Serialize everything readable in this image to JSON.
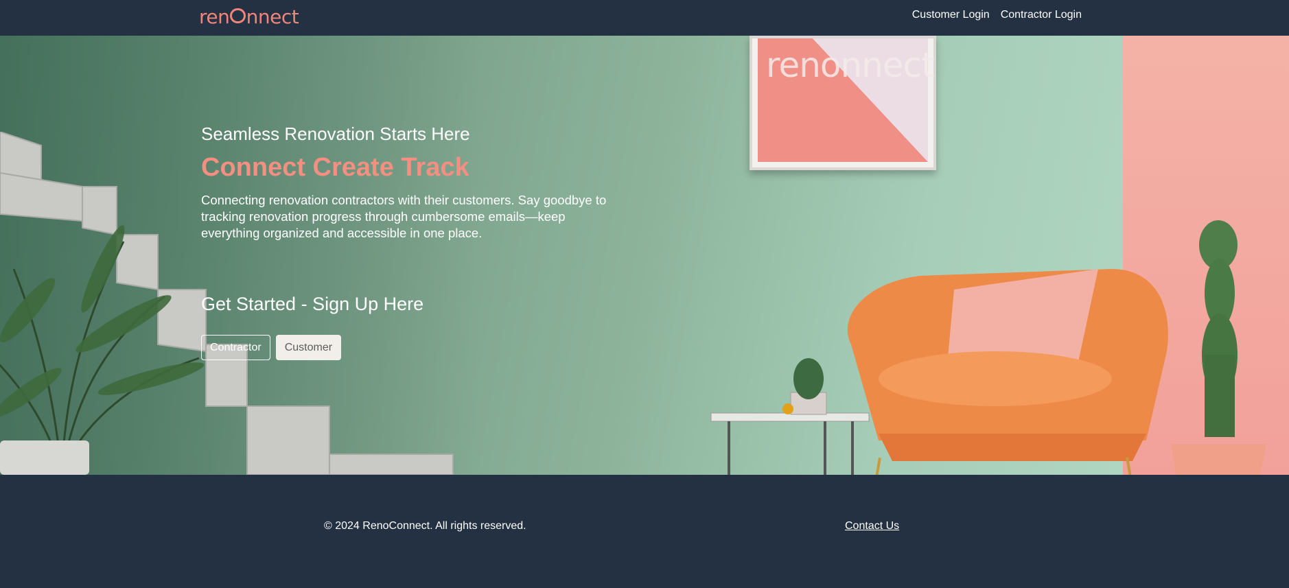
{
  "header": {
    "logo_text_a": "ren",
    "logo_text_b": "nnect",
    "nav": [
      {
        "label": "Customer Login"
      },
      {
        "label": "Contractor Login"
      }
    ]
  },
  "hero": {
    "frame_logo": "renonnect",
    "eyebrow": "Seamless Renovation Starts Here",
    "headline": "Connect Create Track",
    "description": "Connecting renovation contractors with their customers. Say goodbye to tracking renovation progress through cumbersome emails—keep everything organized and accessible in one place.",
    "cta_title": "Get Started - Sign Up Here",
    "buttons": {
      "contractor": "Contractor",
      "customer": "Customer"
    }
  },
  "footer": {
    "copyright": "© 2024 RenoConnect. All rights reserved.",
    "contact": "Contact Us"
  },
  "colors": {
    "nav_bg": "#243143",
    "accent": "#f58f82",
    "wall_green": "#8db49b",
    "wall_pink": "#f2a19a",
    "chair_orange": "#ef8b48"
  }
}
